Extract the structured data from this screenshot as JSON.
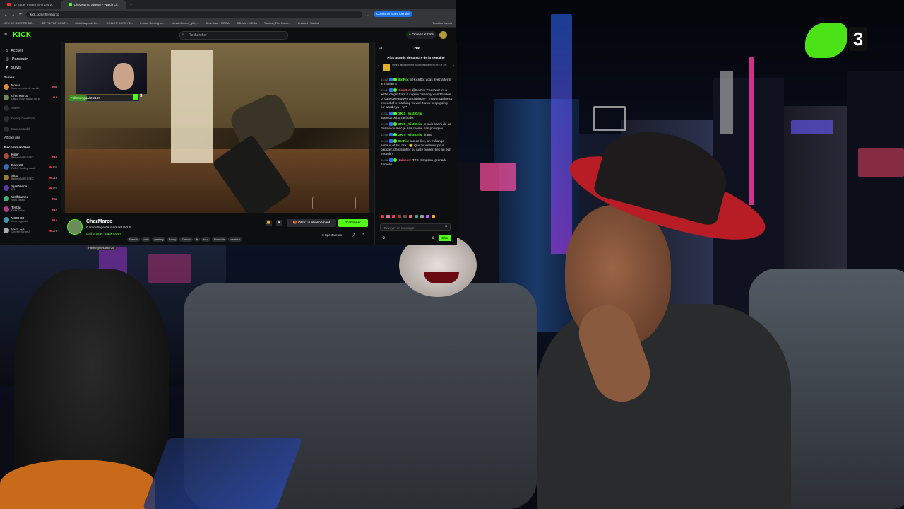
{
  "browser": {
    "tabs": [
      "(1) Super Futuro 80% UNIV...",
      "ChezMarco Stream - Watch Li..."
    ],
    "url": "kick.com/chezmarco",
    "profile_chip": "Confirmer votre identité",
    "bookmarks": [
      "JEU DE GUERRE DE...",
      "IDT FR/TOP COMP...",
      "Kick Kaupunki Le...",
      "ROLLER DERBY 2...",
      "Instant Gaming.co...",
      "dessinGamer_gif.ty...",
      "Download - MEGA",
      "ICDeals - MEGA",
      "Sabius | The Comp...",
      "Unlisted | Sabius",
      "Tous les favoris"
    ]
  },
  "kick": {
    "logo": "KICK",
    "search_placeholder": "Rechercher",
    "get_kicks": "Obtenir KICKs",
    "nav": [
      {
        "icon": "home-icon",
        "label": "Accueil"
      },
      {
        "icon": "compass-icon",
        "label": "Parcourir"
      },
      {
        "icon": "heart-icon",
        "label": "Suivis"
      }
    ],
    "followed_header": "Suivis",
    "followed": [
      {
        "name": "Novad",
        "game": "Juste on mate de morale",
        "viewers": "55",
        "color": "#d98a3a"
      },
      {
        "name": "ChezMarco",
        "game": "Call of Duty: Black Ops 6",
        "viewers": "3",
        "color": "#6b8c5a"
      },
      {
        "name": "Sweet",
        "game": "",
        "viewers": "",
        "color": "#555"
      },
      {
        "name": "Quelqu'unalbum",
        "game": "",
        "viewers": "",
        "color": "#555"
      },
      {
        "name": "Bananasadd",
        "game": "",
        "viewers": "",
        "color": "#555"
      }
    ],
    "show_more": "Afficher plus",
    "recommended_header": "Recommandées",
    "recommended": [
      {
        "name": "Kster",
        "game": "Battlefield REDSEC",
        "viewers": "15",
        "color": "#b04a3a"
      },
      {
        "name": "DanzeD",
        "game": "PUBG: Battlegrounds",
        "viewers": "127",
        "color": "#3a6ab0"
      },
      {
        "name": "Sig1",
        "game": "Battlefield REDSEC",
        "viewers": "215",
        "color": "#9a7a3a"
      },
      {
        "name": "Syrebaena",
        "game": "IRL",
        "viewers": "777",
        "color": "#5a3ab0"
      },
      {
        "name": "Wolfshanee",
        "game": "Slots casino",
        "viewers": "33",
        "color": "#3ab07a"
      },
      {
        "name": "Test3g",
        "game": "Delta Force",
        "viewers": "12",
        "color": "#b03a8a"
      },
      {
        "name": "YOSH33",
        "game": "Apex Legends",
        "viewers": "15",
        "color": "#3a9ab0"
      },
      {
        "name": "CCT_CS",
        "game": "Counter-Strike 2",
        "viewers": "279",
        "color": "#aaa"
      }
    ],
    "follower_goal": "Follower goal 26/100",
    "follower_goal_progress": 0.26,
    "goal_count": "3",
    "channel": {
      "name": "ChezMarco",
      "title": "Camouflage Or diamant BO 6",
      "game": "Call of Duty: Black Ops 6",
      "tags": [
        "French",
        "chill",
        "gaming",
        "funny",
        "French",
        "fr",
        "tour",
        "Francais",
        "carrière",
        "FarmingSimulator25"
      ],
      "viewers_text": "3 Spectateurs",
      "sub_button": "Offrir un abonnement",
      "follow_button": "S'abonner"
    },
    "chat": {
      "title": "Chat",
      "top_header": "Plus grands donateurs de la semaine",
      "top_sub": "Offrir 1 abonnement pour possiblement être le 1er",
      "input_placeholder": "Envoyer un message",
      "send_button": "Chat",
      "messages": [
        {
          "time": "13:42",
          "user": "BotRix",
          "color": "#53fc18",
          "text": "@KickBot vous avez atteint le niveau 3"
        },
        {
          "time": "13:42",
          "user": "KickBot",
          "color": "#ff5e5e",
          "text": "@BotRix **hewwo! im a wittle catgirl from a supew cweamy wand fuwwe of cute cweatuwes and things!** mow mow im so pwoud of u reaching wewel 3 uwu keep going fur-ward nya~ *w*"
        },
        {
          "time": "13:51",
          "user": "GRIS_MistiGris",
          "color": "#53fc18",
          "text": "tirano1700borrachudo:"
        },
        {
          "time": "13:53",
          "user": "GRIS_MistiGris",
          "color": "#53fc18",
          "text": "je suis banni de sa chaine ou mec je sais meme pas pourquoi"
        },
        {
          "time": "13:58",
          "user": "GRIS_MistiGris",
          "color": "#53fc18",
          "text": "tirano"
        },
        {
          "time": "13:59",
          "user": "BotRix",
          "color": "#53fc18",
          "text": "sur ce live, on mélange sérieux et fou rire ! 😄 Que tu viennes pour papoter, philosopher ou juste rigoler, t'es au bon endroit !"
        },
        {
          "time": "13:58",
          "user": "Kaiosen",
          "color": "#ff5e5e",
          "text": "TTS !simpson !grenade !tomero"
        }
      ]
    }
  },
  "overlay": {
    "goal_number": "3"
  }
}
